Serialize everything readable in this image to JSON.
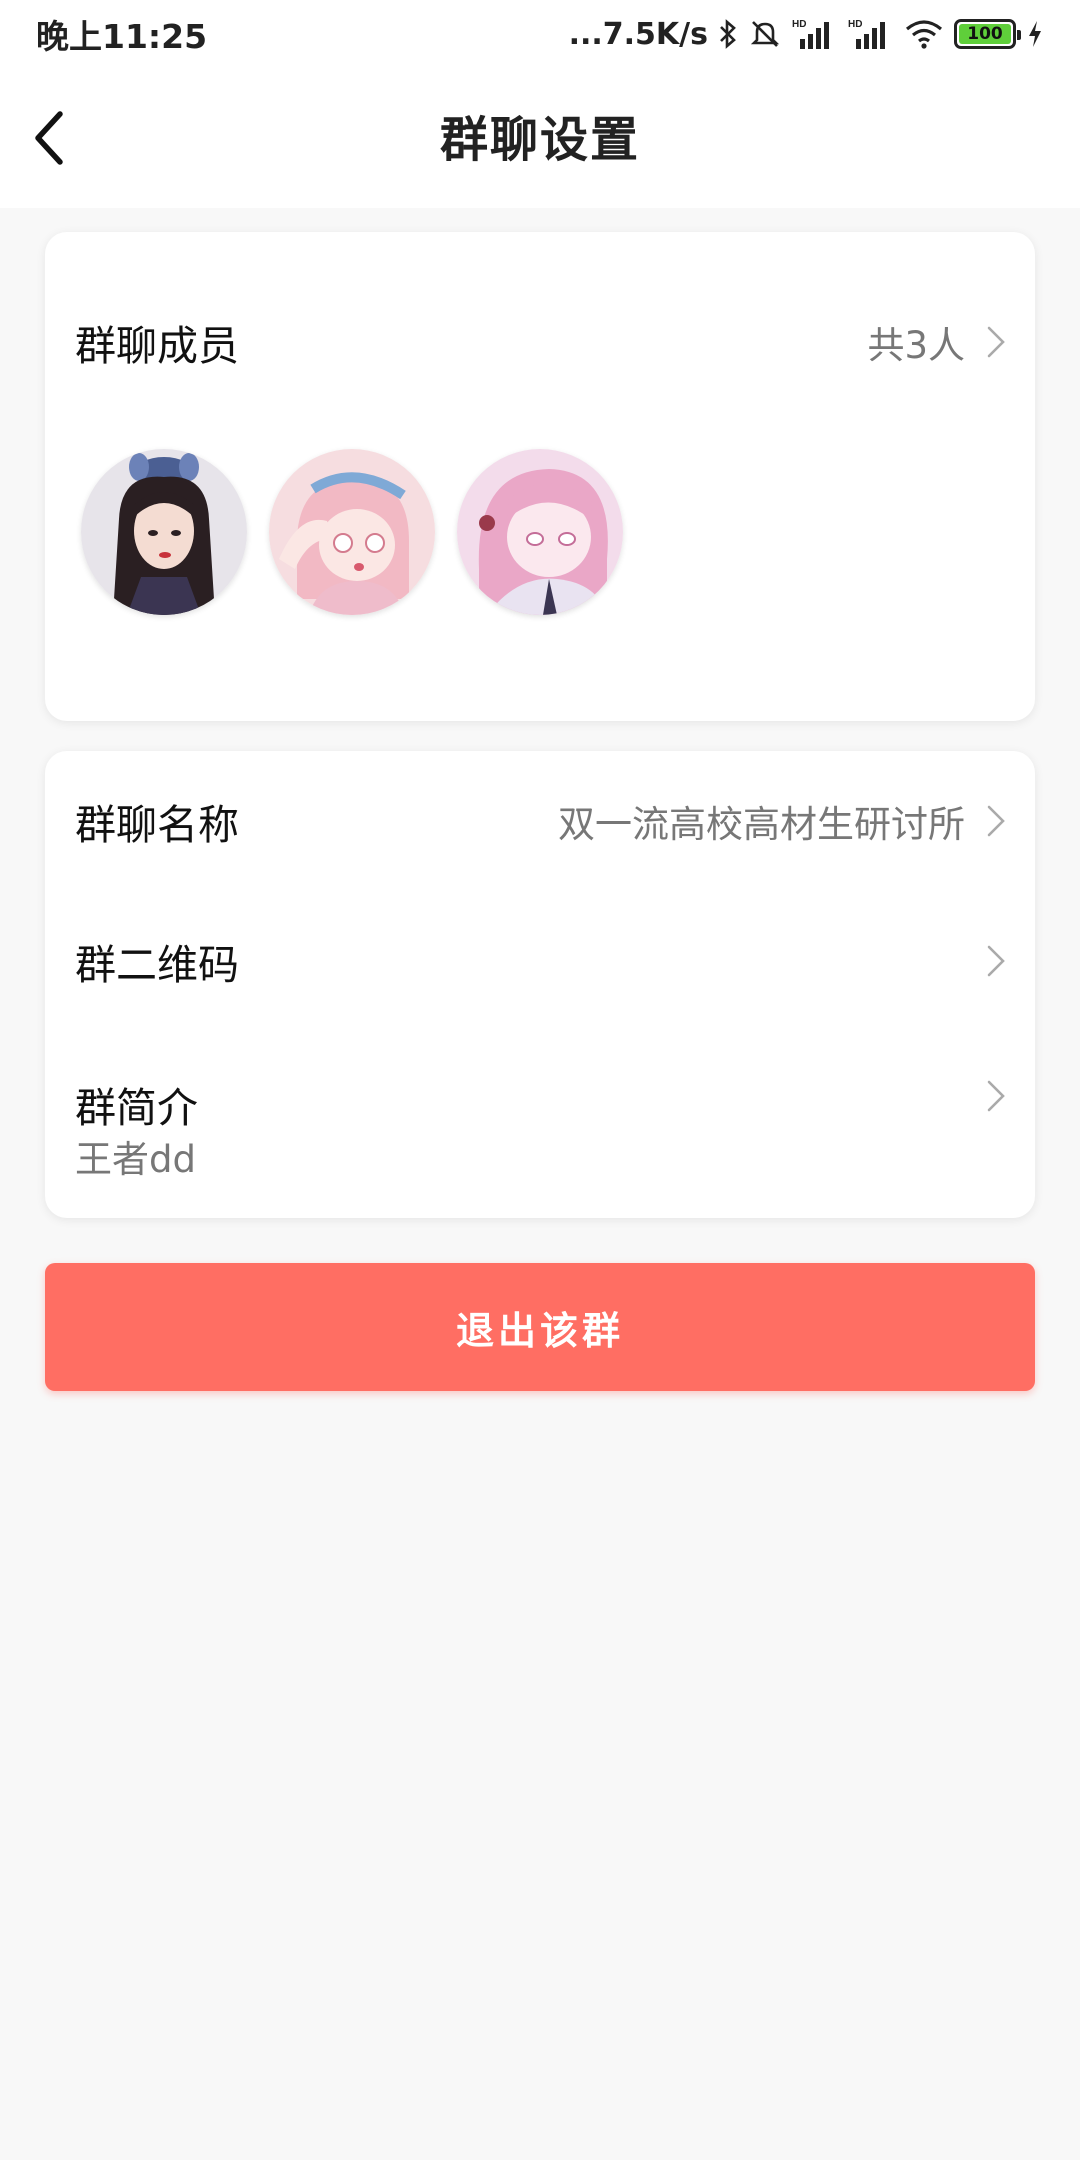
{
  "status_bar": {
    "time": "晚上11:25",
    "net_speed": "...7.5K/s",
    "battery": "100",
    "icons": [
      "bluetooth-icon",
      "mute-bell-icon",
      "hd-signal-icon",
      "hd-signal-icon",
      "wifi-icon",
      "battery-icon",
      "charging-icon"
    ]
  },
  "header": {
    "title": "群聊设置",
    "back_icon": "back-arrow-icon"
  },
  "members": {
    "label": "群聊成员",
    "count": "共3人",
    "avatars": [
      {
        "name": "member-avatar-1",
        "colors": {
          "bg": "#e7e4ea",
          "accent": "#3a2a2a"
        }
      },
      {
        "name": "member-avatar-2",
        "colors": {
          "bg": "#f6dde0",
          "accent": "#f0a9b5"
        }
      },
      {
        "name": "member-avatar-3",
        "colors": {
          "bg": "#f3dceb",
          "accent": "#e8a5c6"
        }
      }
    ]
  },
  "info": {
    "group_name_label": "群聊名称",
    "group_name_value": "双一流高校高材生研讨所",
    "qr_label": "群二维码",
    "intro_label": "群简介",
    "intro_value": "王者dd"
  },
  "exit_button": {
    "label": "退出该群"
  },
  "colors": {
    "accent": "#ff6e63",
    "background": "#f8f8f8",
    "card": "#ffffff",
    "secondary_text": "#777777"
  }
}
